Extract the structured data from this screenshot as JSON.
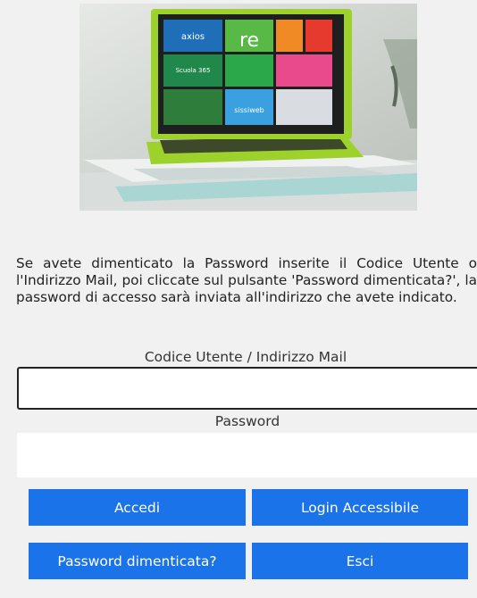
{
  "hero": {
    "image_name": "laptop-on-books"
  },
  "tiles": {
    "axios": "axios",
    "re": "re",
    "scuola": "Scuola 365",
    "sissiweb": "sissiweb"
  },
  "info_text": "Se avete dimenticato la Password inserite il Codice Utente o l'Indirizzo Mail, poi cliccate sul pulsante 'Password dimenticata?', la password di accesso sarà inviata all'indirizzo che avete indicato.",
  "form": {
    "user_label": "Codice Utente / Indirizzo Mail",
    "user_value": "",
    "password_label": "Password",
    "password_value": ""
  },
  "buttons": {
    "accedi": "Accedi",
    "login_accessibile": "Login Accessibile",
    "password_dimenticata": "Password dimenticata?",
    "esci": "Esci"
  },
  "colors": {
    "button": "#1a73e8",
    "background": "#f1f1f1"
  }
}
